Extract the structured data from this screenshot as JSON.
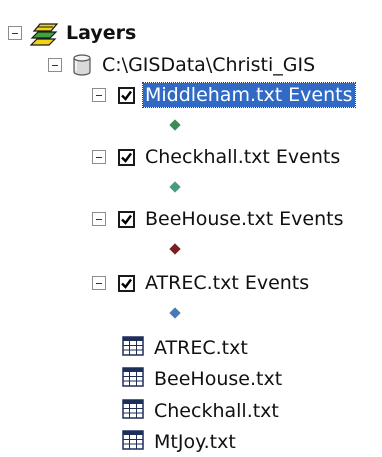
{
  "toc": {
    "root": {
      "label": "Layers",
      "icon": "layers-icon",
      "expanded": true
    },
    "workspace": {
      "label": "C:\\GISData\\Christi_GIS",
      "icon": "database-icon",
      "expanded": true
    },
    "layers": [
      {
        "label": "Middleham.txt Events",
        "checked": true,
        "selected": true,
        "symbol_color": "#3d8a56"
      },
      {
        "label": "Checkhall.txt Events",
        "checked": true,
        "selected": false,
        "symbol_color": "#4a9a80"
      },
      {
        "label": "BeeHouse.txt Events",
        "checked": true,
        "selected": false,
        "symbol_color": "#7a1f1f"
      },
      {
        "label": "ATREC.txt Events",
        "checked": true,
        "selected": false,
        "symbol_color": "#4a78b5"
      }
    ],
    "tables": [
      {
        "label": "ATREC.txt",
        "icon": "table-icon"
      },
      {
        "label": "BeeHouse.txt",
        "icon": "table-icon"
      },
      {
        "label": "Checkhall.txt",
        "icon": "table-icon"
      },
      {
        "label": "MtJoy.txt",
        "icon": "table-icon"
      }
    ]
  },
  "colors": {
    "selection": "#316ac5",
    "layers_icon_yellow": "#f2d21b",
    "layers_icon_green": "#3aa53a"
  }
}
